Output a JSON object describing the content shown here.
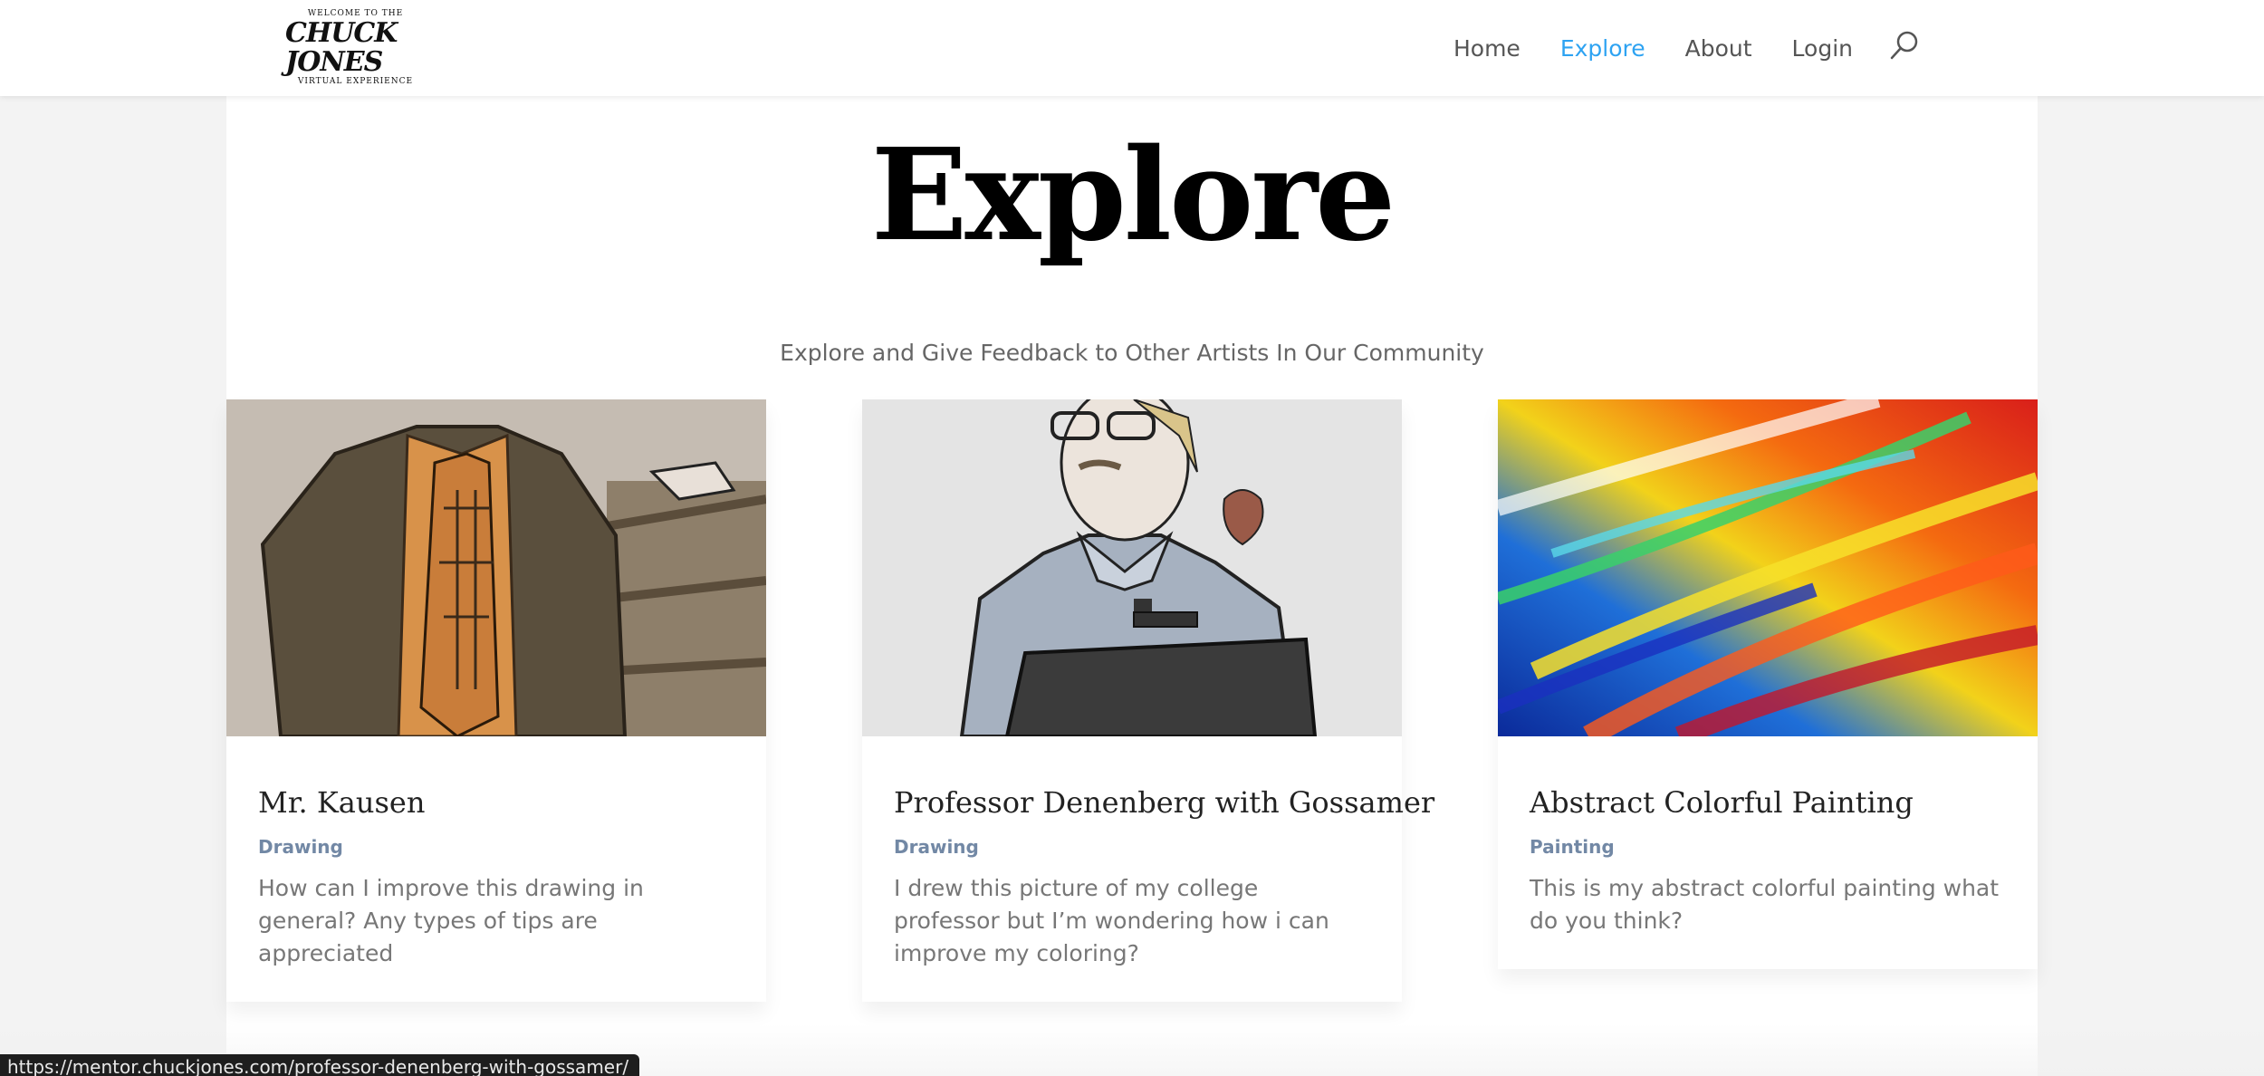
{
  "header": {
    "logo": {
      "small_top": "WELCOME TO THE",
      "brand": "CHUCK JONES",
      "small_bottom": "VIRTUAL EXPERIENCE"
    },
    "nav": [
      {
        "label": "Home"
      },
      {
        "label": "Explore"
      },
      {
        "label": "About"
      },
      {
        "label": "Login"
      }
    ],
    "search_icon": "search-icon"
  },
  "main": {
    "title": "Explore",
    "subtitle": "Explore and Give Feedback to Other Artists In Our Community",
    "cards": [
      {
        "title": "Mr. Kausen",
        "category": "Drawing",
        "description": "How can I improve this drawing in general? Any types of tips are appreciated"
      },
      {
        "title": "Professor Denenberg with Gossamer",
        "category": "Drawing",
        "description": "I drew this picture of my college professor but I’m wondering how i can improve my coloring?"
      },
      {
        "title": "Abstract Colorful Painting",
        "category": "Painting",
        "description": "This is my abstract colorful painting what do you think?"
      }
    ]
  },
  "status_bar": {
    "url": "https://mentor.chuckjones.com/professor-denenberg-with-gossamer/"
  },
  "colors": {
    "accent": "#2ea3f2",
    "category": "#7288a5",
    "nav_text": "#555555"
  }
}
